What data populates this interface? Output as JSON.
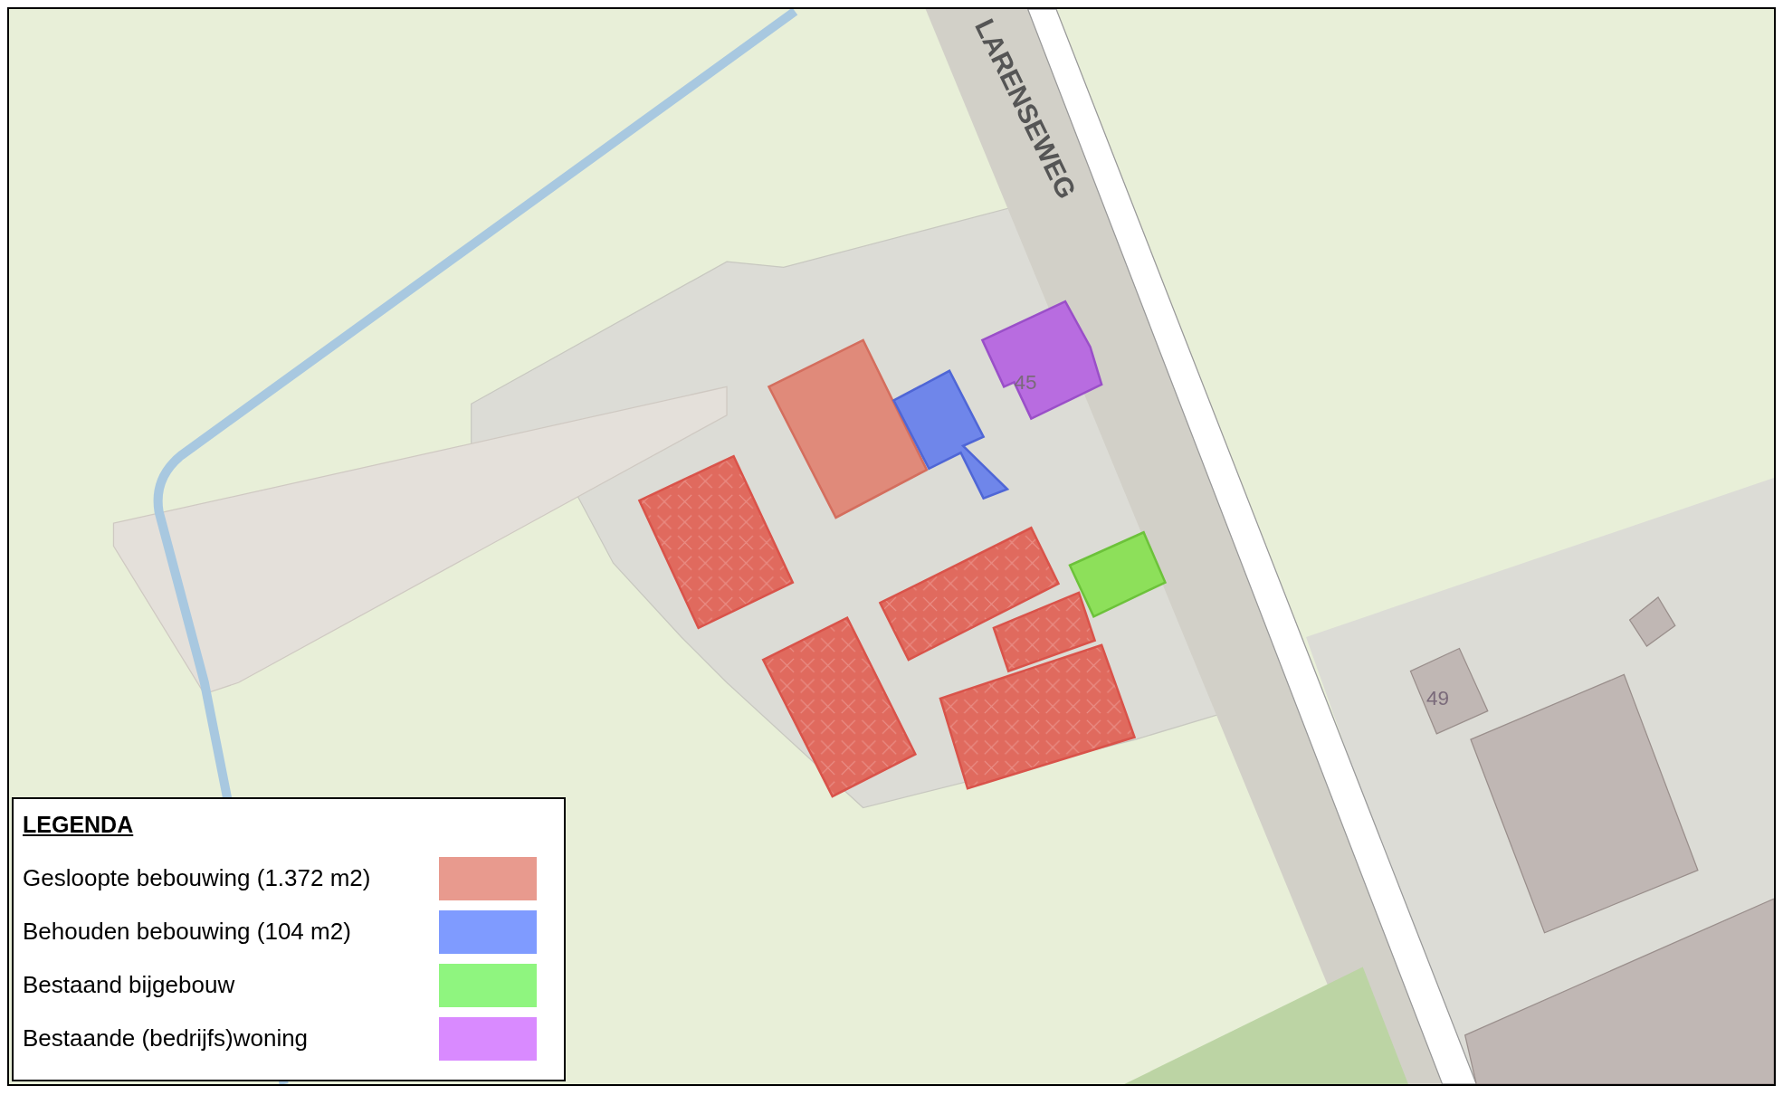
{
  "map": {
    "road_label": "LARENSEWEG",
    "house_numbers": [
      "45",
      "49"
    ],
    "buildings": [
      {
        "kind": "demolished-plain"
      },
      {
        "kind": "retained"
      },
      {
        "kind": "dwelling"
      },
      {
        "kind": "annex"
      },
      {
        "kind": "demolished"
      },
      {
        "kind": "demolished"
      },
      {
        "kind": "demolished"
      },
      {
        "kind": "demolished"
      },
      {
        "kind": "demolished"
      }
    ]
  },
  "legend": {
    "title": "LEGENDA",
    "items": [
      {
        "label": "Gesloopte bebouwing (1.372 m2)",
        "color": "#e89a8e"
      },
      {
        "label": "Behouden bebouwing (104 m2)",
        "color": "#7f9bff"
      },
      {
        "label": "Bestaand bijgebouw",
        "color": "#8ff57f"
      },
      {
        "label": "Bestaande (bedrijfs)woning",
        "color": "#d98aff"
      }
    ]
  }
}
